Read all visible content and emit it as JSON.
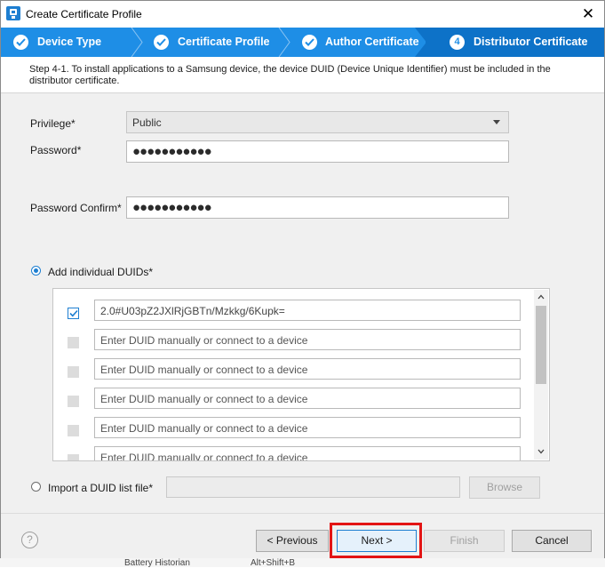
{
  "window": {
    "title": "Create Certificate Profile"
  },
  "stepper": {
    "steps": [
      {
        "label": "Device Type",
        "state": "done"
      },
      {
        "label": "Certificate Profile",
        "state": "done"
      },
      {
        "label": "Author Certificate",
        "state": "done"
      },
      {
        "label": "Distributor Certificate",
        "state": "active",
        "number": "4"
      }
    ],
    "colors": {
      "bar": "#1e8ee6",
      "active": "#0d72c8"
    }
  },
  "banner": {
    "text": "Step 4-1. To install applications to a Samsung device, the device DUID (Device Unique Identifier) must be included in the distributor certificate."
  },
  "form": {
    "privilege": {
      "label": "Privilege*",
      "value": "Public"
    },
    "password": {
      "label": "Password*",
      "masked": "●●●●●●●●●●●"
    },
    "password_confirm": {
      "label": "Password Confirm*",
      "masked": "●●●●●●●●●●●"
    }
  },
  "duids": {
    "add_label": "Add individual DUIDs*",
    "placeholder": "Enter DUID manually or connect to a device",
    "rows": [
      {
        "checked": true,
        "value": "2.0#U03pZ2JXlRjGBTn/Mzkkg/6Kupk="
      },
      {
        "checked": false,
        "value": ""
      },
      {
        "checked": false,
        "value": ""
      },
      {
        "checked": false,
        "value": ""
      },
      {
        "checked": false,
        "value": ""
      },
      {
        "checked": false,
        "value": ""
      }
    ]
  },
  "import": {
    "label": "Import a DUID list file*",
    "browse_label": "Browse"
  },
  "footer": {
    "help_symbol": "?",
    "previous_label": "< Previous",
    "next_label": "Next >",
    "finish_label": "Finish",
    "cancel_label": "Cancel"
  },
  "background": {
    "left_text": "Battery Historian",
    "right_text": "Alt+Shift+B"
  }
}
